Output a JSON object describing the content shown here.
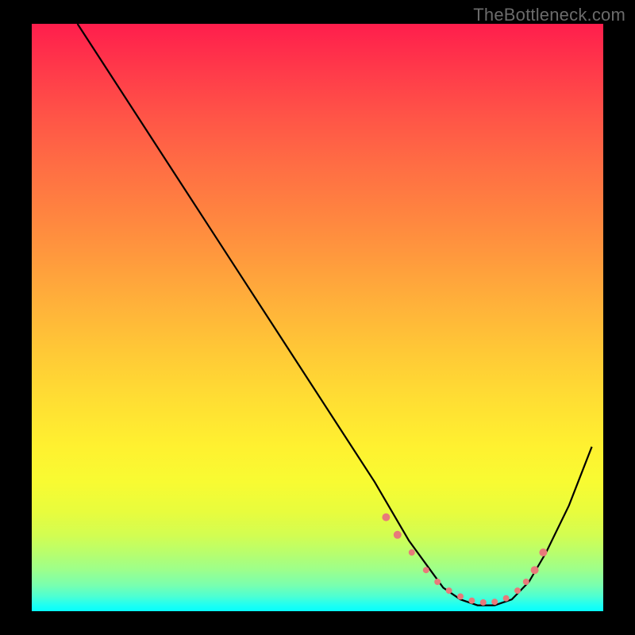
{
  "watermark": "TheBottleneck.com",
  "chart_data": {
    "type": "line",
    "title": "",
    "xlabel": "",
    "ylabel": "",
    "xlim": [
      0,
      100
    ],
    "ylim": [
      0,
      100
    ],
    "grid": false,
    "legend": false,
    "background_gradient": {
      "top": "#ff1e4c",
      "bottom": "#06fffd",
      "comment": "red (high) → yellow (mid) → green/cyan (low) bottleneck severity gradient"
    },
    "series": [
      {
        "name": "bottleneck-curve",
        "color": "#000000",
        "x": [
          8,
          12,
          18,
          24,
          30,
          36,
          42,
          48,
          54,
          60,
          63,
          66,
          69,
          72,
          75,
          78,
          81,
          84,
          87,
          90,
          94,
          98
        ],
        "values": [
          100,
          94,
          85,
          76,
          67,
          58,
          49,
          40,
          31,
          22,
          17,
          12,
          8,
          4,
          2,
          1,
          1,
          2,
          5,
          10,
          18,
          28
        ]
      }
    ],
    "markers": {
      "name": "dotted-optimal-zone",
      "color": "#e87a7a",
      "x": [
        62,
        64,
        66.5,
        69,
        71,
        73,
        75,
        77,
        79,
        81,
        83,
        85,
        86.5,
        88,
        89.5
      ],
      "values": [
        16,
        13,
        10,
        7,
        5,
        3.5,
        2.5,
        1.8,
        1.5,
        1.6,
        2.2,
        3.5,
        5,
        7,
        10
      ]
    }
  }
}
